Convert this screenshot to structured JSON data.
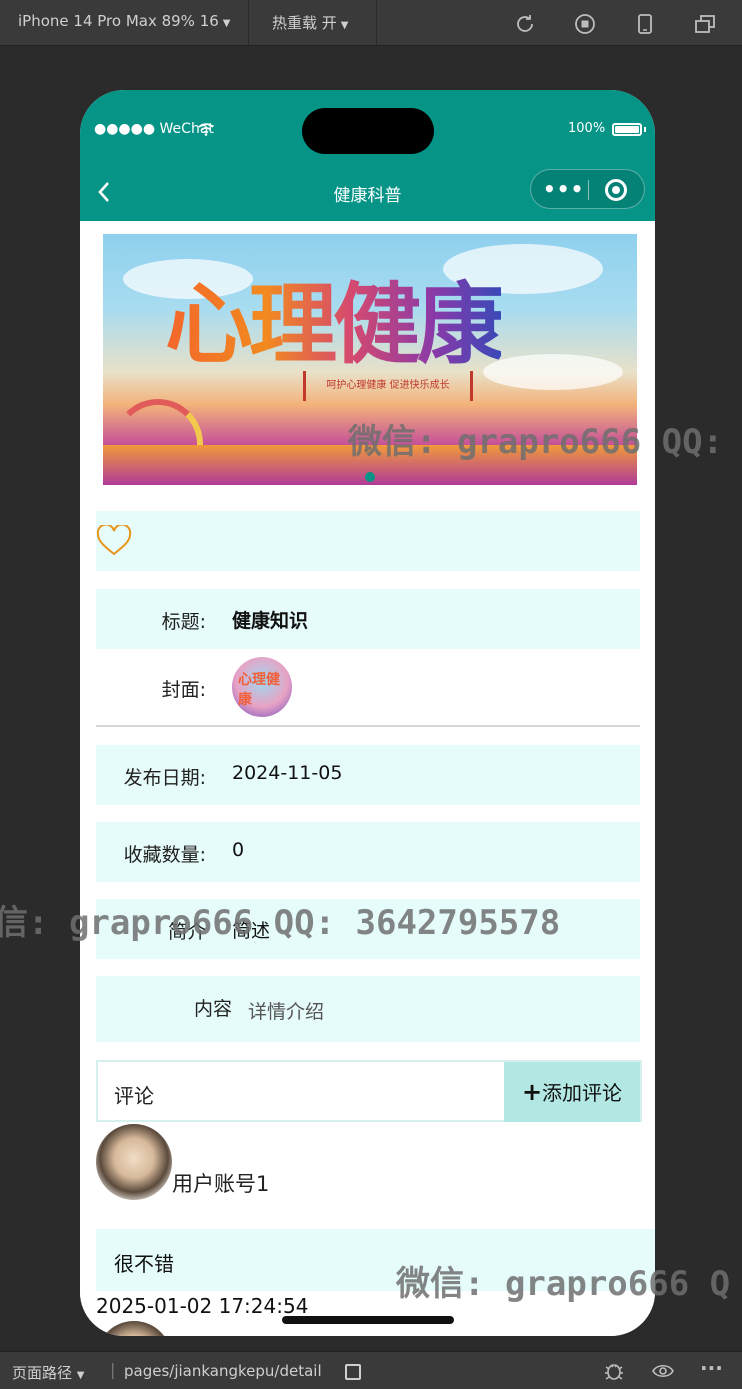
{
  "devtools": {
    "device_label": "iPhone 14 Pro Max 89% 16",
    "hot_reload_label": "热重载 开",
    "path_label": "页面路径",
    "page_path": "pages/jiankangkepu/detail"
  },
  "phone": {
    "carrier": "●●●●● WeChat",
    "battery": "100%",
    "nav_title": "健康科普",
    "banner": {
      "headline": "心理健康",
      "subline": "呵护心理健康 促进快乐成长"
    },
    "fields": {
      "title_label": "标题:",
      "title_value": "健康知识",
      "cover_label": "封面:",
      "date_label": "发布日期:",
      "date_value": "2024-11-05",
      "favorites_label": "收藏数量:",
      "favorites_value": "0",
      "intro_label": "简介",
      "intro_value": "简述",
      "content_label": "内容",
      "content_value": "详情介绍"
    },
    "comments": {
      "section_label": "评论",
      "add_button_icon": "+",
      "add_button_label": "添加评论",
      "items": [
        {
          "username": "用户账号1",
          "text": "很不错",
          "time": "2025-01-02 17:24:54"
        }
      ]
    }
  },
  "watermark": {
    "text_1": "微信: grapro666 QQ:",
    "text_2": "信: grapro666 QQ: 3642795578",
    "text_3": "微信: grapro666 Q"
  },
  "colors": {
    "accent": "#069487",
    "row_bg": "#e6fcfb",
    "button_bg": "#b2e7e3",
    "heart": "#e8951c"
  }
}
